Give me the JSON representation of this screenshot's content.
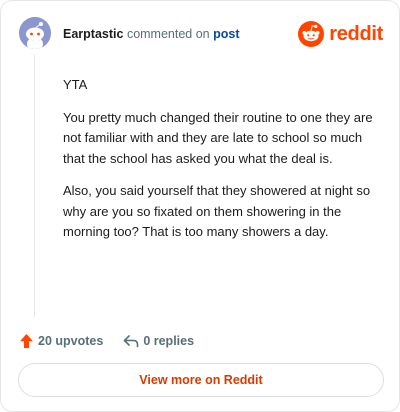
{
  "comment": {
    "author": "Earptastic",
    "verb": "commented on",
    "target": "post",
    "paragraphs": [
      "YTA",
      "You pretty much changed their routine to one they are not familiar with and they are late to school so much that the school has asked you what the deal is.",
      "Also, you said yourself that they showered at night so why are you so fixated on them showering in the morning too? That is too many showers a day."
    ]
  },
  "brand": {
    "name": "reddit",
    "icon": "reddit-snoo-icon",
    "color": "#ff4500"
  },
  "actions": {
    "upvotes_label": "20 upvotes",
    "upvote_icon": "upvote-arrow-icon",
    "replies_label": "0 replies",
    "reply_icon": "reply-arrow-icon"
  },
  "view_more_label": "View more on Reddit",
  "colors": {
    "accent": "#d93a00",
    "upvote": "#ff4500",
    "link": "#0a4a9c"
  }
}
